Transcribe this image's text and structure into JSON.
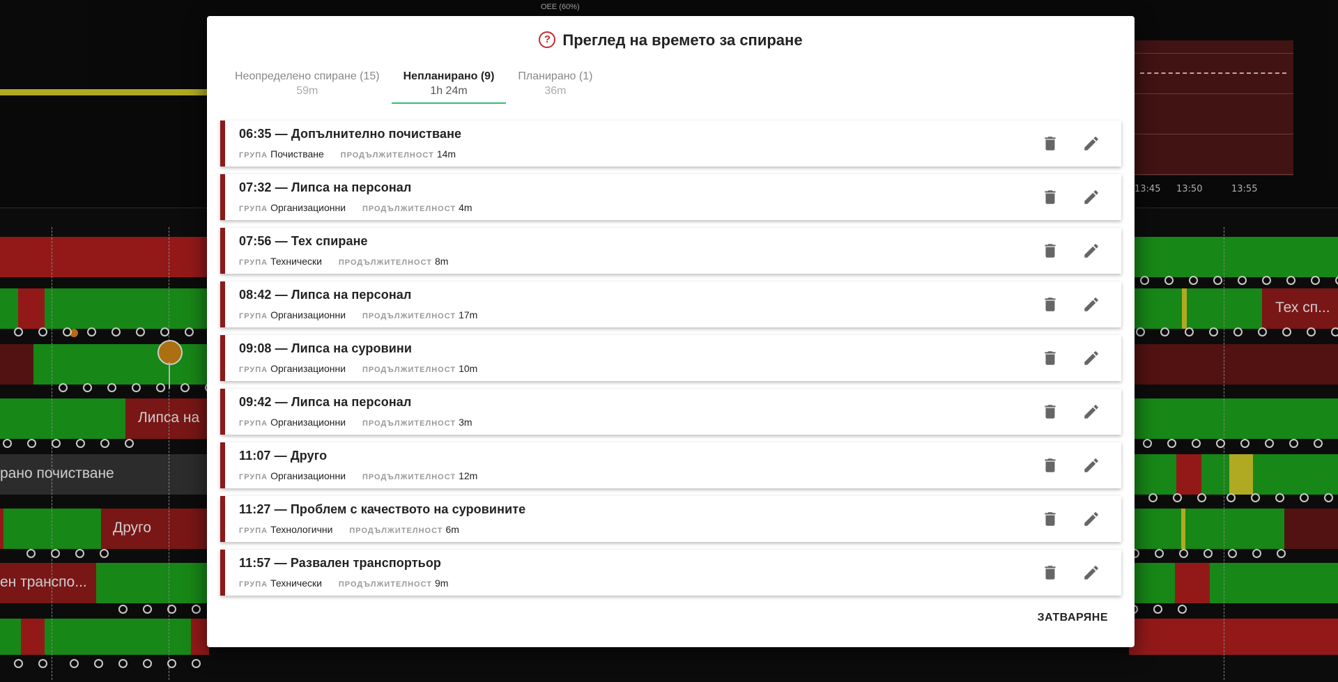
{
  "background": {
    "oee_label": "OEE (60%)",
    "ticks": [
      "13:45",
      "13:50",
      "13:55"
    ],
    "row_labels": [
      "Тех сп...",
      "Липса на",
      "рано почистване",
      "Друго",
      "ен транспо..."
    ]
  },
  "dialog": {
    "title": "Преглед на времето за спиране",
    "tabs": [
      {
        "label": "Неопределено спиране (15)",
        "sub": "59m"
      },
      {
        "label": "Непланирано (9)",
        "sub": "1h 24m"
      },
      {
        "label": "Планирано (1)",
        "sub": "36m"
      }
    ],
    "active_tab": 1,
    "group_key": "ГРУПА",
    "duration_key": "ПРОДЪЛЖИТЕЛНОСТ",
    "items": [
      {
        "title": "06:35 — Допълнително почистване",
        "group": "Почистване",
        "duration": "14m"
      },
      {
        "title": "07:32 — Липса на персонал",
        "group": "Организационни",
        "duration": "4m"
      },
      {
        "title": "07:56 — Тех спиране",
        "group": "Технически",
        "duration": "8m"
      },
      {
        "title": "08:42 — Липса на персонал",
        "group": "Организационни",
        "duration": "17m"
      },
      {
        "title": "09:08 — Липса на суровини",
        "group": "Организационни",
        "duration": "10m"
      },
      {
        "title": "09:42 — Липса на персонал",
        "group": "Организационни",
        "duration": "3m"
      },
      {
        "title": "11:07 — Друго",
        "group": "Организационни",
        "duration": "12m"
      },
      {
        "title": "11:27 — Проблем с качеството на суровините",
        "group": "Технологични",
        "duration": "6m"
      },
      {
        "title": "11:57 — Развален транспортьор",
        "group": "Технически",
        "duration": "9m"
      }
    ],
    "close_label": "ЗАТВАРЯНЕ"
  },
  "colors": {
    "accent_green": "#2fbf71",
    "stripe_red": "#8b1a1a",
    "help_red": "#c62828",
    "timeline_green": "#1b9a1b",
    "timeline_red": "#a81d1d",
    "timeline_darkred": "#5e1515",
    "timeline_yellow": "#c9c227"
  },
  "icons": {
    "title_icon": "help-circle-icon",
    "delete_icon": "trash-icon",
    "edit_icon": "pencil-icon"
  }
}
